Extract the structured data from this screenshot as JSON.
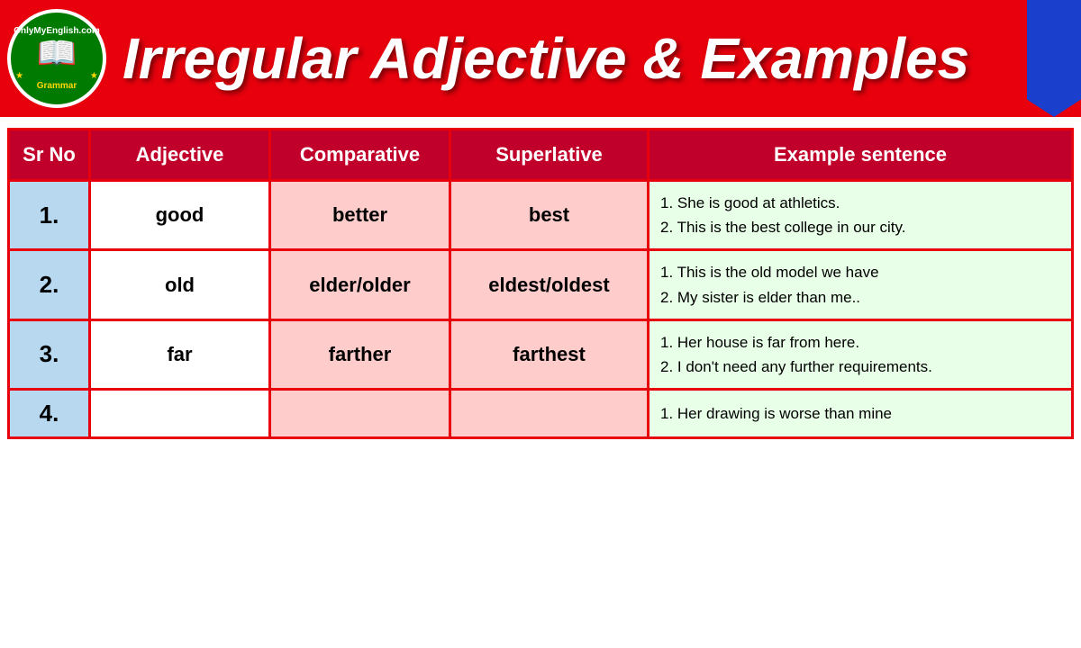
{
  "header": {
    "logo": {
      "top_text": "OnlyMyEnglish.com",
      "bottom_text": "Grammar",
      "book_icon": "📖"
    },
    "title": "Irregular Adjective & Examples"
  },
  "table": {
    "columns": [
      "Sr No",
      "Adjective",
      "Comparative",
      "Superlative",
      "Example sentence"
    ],
    "rows": [
      {
        "sr": "1.",
        "adjective": "good",
        "comparative": "better",
        "superlative": "best",
        "examples": [
          "1. She is good at athletics.",
          "2. This is the best college in our city."
        ]
      },
      {
        "sr": "2.",
        "adjective": "old",
        "comparative": "elder/older",
        "superlative": "eldest/oldest",
        "examples": [
          "1. This is the old model we have",
          "2. My sister is elder than me.."
        ]
      },
      {
        "sr": "3.",
        "adjective": "far",
        "comparative": "farther",
        "superlative": "farthest",
        "examples": [
          "1. Her house is far from here.",
          "2. I don't need any further requirements."
        ]
      },
      {
        "sr": "4.",
        "adjective": "",
        "comparative": "",
        "superlative": "",
        "examples": [
          "1. Her drawing is worse than mine"
        ]
      }
    ]
  }
}
